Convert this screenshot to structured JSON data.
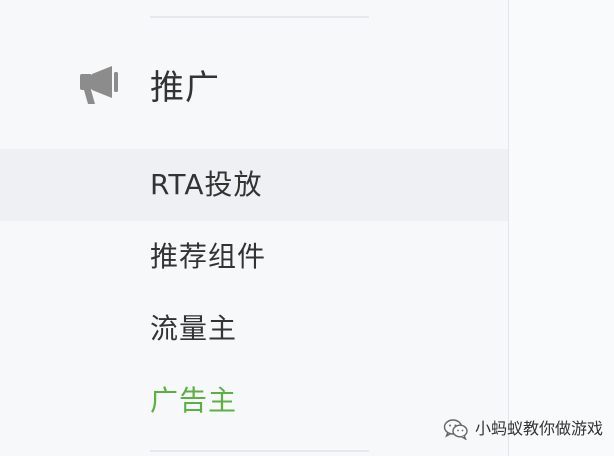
{
  "section": {
    "icon": "megaphone-icon",
    "title": "推广"
  },
  "menu": {
    "items": [
      {
        "label": "RTA投放",
        "active": true
      },
      {
        "label": "推荐组件",
        "active": false
      },
      {
        "label": "流量主",
        "active": false
      },
      {
        "label": "广告主",
        "active": false,
        "color": "#5bb043"
      }
    ]
  },
  "watermark": {
    "icon": "wechat-icon",
    "text": "小蚂蚁教你做游戏"
  },
  "colors": {
    "background": "#f7f8fa",
    "active_row": "#eef0f3",
    "text": "#333333",
    "accent_green": "#5bb043",
    "icon_gray": "#8c8c8c"
  }
}
